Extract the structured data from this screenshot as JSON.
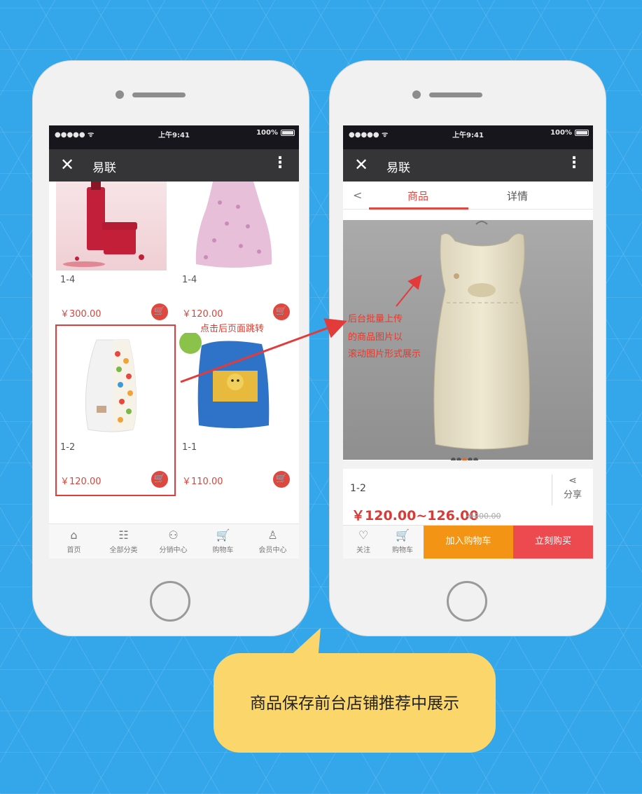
{
  "status_bar": {
    "signal": "●●●●● ᯤ",
    "time": "上午9:41",
    "battery": "100%"
  },
  "navbar": {
    "close_icon": "close-icon",
    "title": "易联",
    "more_icon": "more-vertical-icon"
  },
  "product_list": [
    {
      "name": "1-4",
      "price": "￥300.00",
      "image": "cosmetics-bottles"
    },
    {
      "name": "1-4",
      "price": "￥120.00",
      "image": "pink-baby-sleeping-bag"
    },
    {
      "name": "1-2",
      "price": "￥120.00",
      "image": "polka-dot-sleeping-bag",
      "highlighted": true
    },
    {
      "name": "1-1",
      "price": "￥110.00",
      "image": "blue-bear-sleeping-bag"
    }
  ],
  "bottom_tabs": [
    {
      "label": "首页",
      "icon": "home-icon"
    },
    {
      "label": "全部分类",
      "icon": "category-icon"
    },
    {
      "label": "分销中心",
      "icon": "distribution-icon"
    },
    {
      "label": "购物车",
      "icon": "cart-icon"
    },
    {
      "label": "会员中心",
      "icon": "user-icon"
    }
  ],
  "detail": {
    "tabs": [
      "商品",
      "详情"
    ],
    "active_tab": "商品",
    "gallery_image": "cream-baby-sleeping-bag",
    "gallery_dots": 5,
    "gallery_active_dot": 3,
    "product_name": "1-2",
    "share_label": "分享",
    "price": "￥120.00~126.00",
    "original_price": "￥200.00",
    "actions": {
      "follow_label": "关注",
      "cart_label": "购物车",
      "add_to_cart_label": "加入购物车",
      "buy_now_label": "立刻购买"
    }
  },
  "annotations": {
    "jump_note": "点击后页面跳转",
    "upload_note_lines": [
      "后台批量上传",
      "的商品图片以",
      "滚动图片形式展示"
    ]
  },
  "bubble_text": "商品保存前台店铺推荐中展示",
  "colors": {
    "background": "#34a6ea",
    "accent_red": "#e0483f",
    "add_to_cart_orange": "#f39414",
    "buy_now_red": "#ec4a4f",
    "bubble_yellow": "#fbd66a"
  }
}
